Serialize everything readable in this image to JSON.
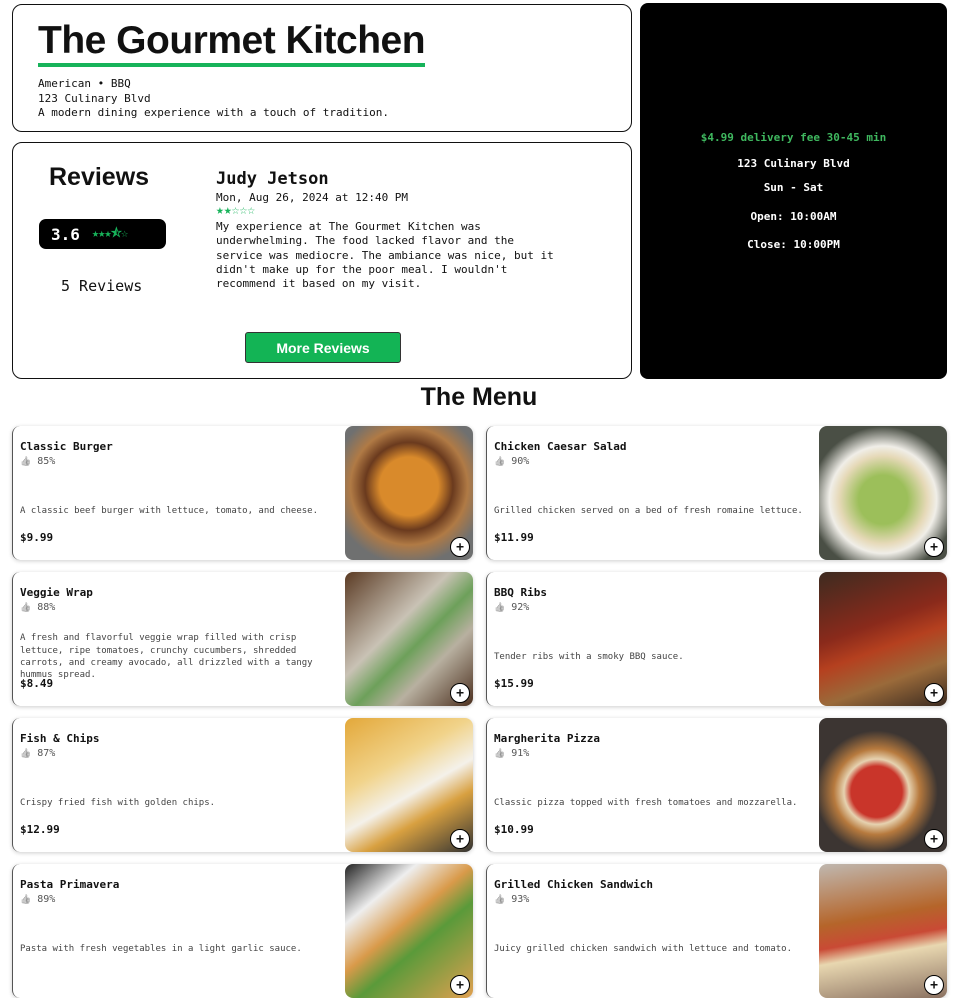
{
  "restaurant": {
    "name": "The Gourmet Kitchen",
    "cuisine": "American • BBQ",
    "address": "123 Culinary Blvd",
    "tagline": "A modern dining experience with a touch of tradition."
  },
  "reviews": {
    "heading": "Reviews",
    "average": "3.6",
    "average_stars": "★★★⯪☆",
    "count_label": "5 Reviews",
    "more_label": "More Reviews",
    "featured": {
      "author": "Judy Jetson",
      "date": "Mon, Aug 26, 2024 at 12:40 PM",
      "stars": "★★☆☆☆",
      "text": "My experience at The Gourmet Kitchen was underwhelming. The food lacked flavor and the service was mediocre. The ambiance was nice, but it didn't make up for the poor meal. I wouldn't recommend it based on my visit."
    }
  },
  "sidebar": {
    "delivery": "$4.99 delivery fee 30-45 min",
    "address": "123 Culinary Blvd",
    "days": "Sun - Sat",
    "open": "Open: 10:00AM",
    "close": "Close: 10:00PM"
  },
  "menu": {
    "heading": "The Menu",
    "items": [
      {
        "name": "Classic Burger",
        "like": "85%",
        "desc": "A classic beef burger with lettuce, tomato, and cheese.",
        "price": "$9.99"
      },
      {
        "name": "Chicken Caesar Salad",
        "like": "90%",
        "desc": "Grilled chicken served on a bed of fresh romaine lettuce.",
        "price": "$11.99"
      },
      {
        "name": "Veggie Wrap",
        "like": "88%",
        "desc": "A fresh and flavorful veggie wrap filled with crisp lettuce, ripe tomatoes, crunchy cucumbers, shredded carrots, and creamy avocado, all drizzled with a tangy hummus spread.",
        "price": "$8.49"
      },
      {
        "name": "BBQ Ribs",
        "like": "92%",
        "desc": "Tender ribs with a smoky BBQ sauce.",
        "price": "$15.99"
      },
      {
        "name": "Fish & Chips",
        "like": "87%",
        "desc": "Crispy fried fish with golden chips.",
        "price": "$12.99"
      },
      {
        "name": "Margherita Pizza",
        "like": "91%",
        "desc": "Classic pizza topped with fresh tomatoes and mozzarella.",
        "price": "$10.99"
      },
      {
        "name": "Pasta Primavera",
        "like": "89%",
        "desc": "Pasta with fresh vegetables in a light garlic sauce.",
        "price": ""
      },
      {
        "name": "Grilled Chicken Sandwich",
        "like": "93%",
        "desc": "Juicy grilled chicken sandwich with lettuce and tomato.",
        "price": ""
      }
    ],
    "add_label": "+",
    "like_icon": "👍"
  },
  "colors": {
    "accent": "#17b35a"
  }
}
